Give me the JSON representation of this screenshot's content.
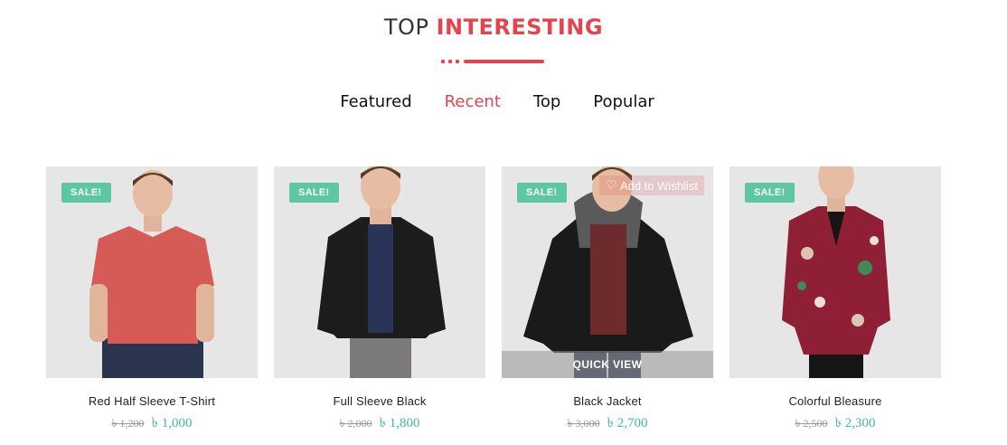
{
  "section": {
    "title_part1": "TOP",
    "title_part2": "INTERESTING"
  },
  "tabs": [
    {
      "label": "Featured",
      "active": false
    },
    {
      "label": "Recent",
      "active": true
    },
    {
      "label": "Top",
      "active": false
    },
    {
      "label": "Popular",
      "active": false
    }
  ],
  "products": [
    {
      "badge": "SALE!",
      "name": "Red Half Sleeve T-Shirt",
      "old_price": "৳ 1,200",
      "price": "৳ 1,000",
      "garment_color": "#d65a55"
    },
    {
      "badge": "SALE!",
      "name": "Full Sleeve Black",
      "old_price": "৳ 2,000",
      "price": "৳ 1,800",
      "garment_color": "#1c1c1c"
    },
    {
      "badge": "SALE!",
      "name": "Black Jacket",
      "old_price": "৳ 3,000",
      "price": "৳ 2,700",
      "garment_color": "#1a1a1a",
      "hover_wishlist": "Add to Wishlist",
      "hover_quickview": "QUICK VIEW"
    },
    {
      "badge": "SALE!",
      "name": "Colorful Bleasure",
      "old_price": "৳ 2,500",
      "price": "৳ 2,300",
      "garment_color": "#8e1f35"
    }
  ],
  "colors": {
    "accent": "#e2454f",
    "sale_badge": "#5cc7a0",
    "price": "#3fb8a2"
  }
}
